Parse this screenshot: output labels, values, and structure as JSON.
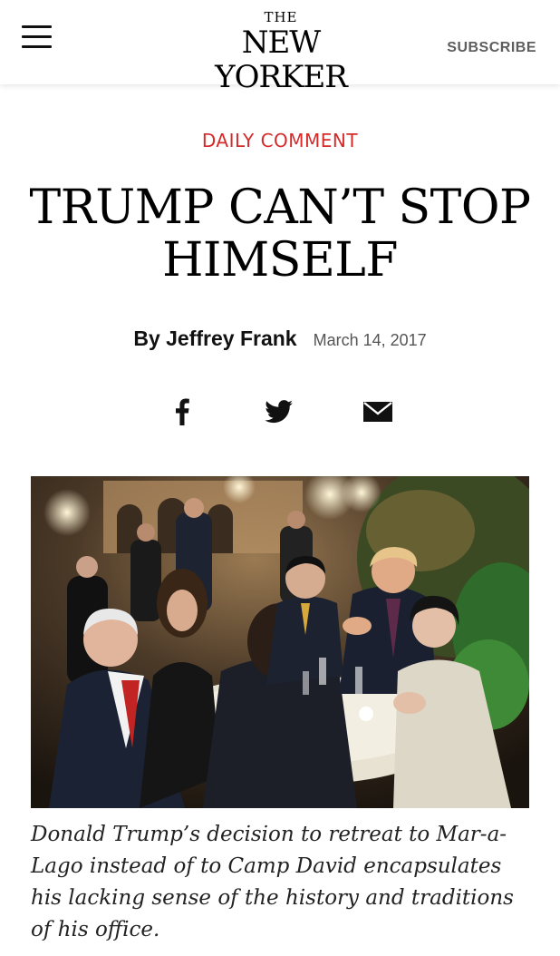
{
  "header": {
    "logo_top": "THE",
    "logo_name": "NEW YORKER",
    "subscribe_label": "SUBSCRIBE",
    "menu_icon": "hamburger-menu-icon"
  },
  "article": {
    "rubric": "DAILY COMMENT",
    "headline_line1": "TRUMP CAN’T STOP",
    "headline_line2": "HIMSELF",
    "byline": "By Jeffrey Frank",
    "date": "March 14, 2017",
    "caption": "Donald Trump’s decision to retreat to Mar-a-Lago instead of to Camp David encapsulates his lacking sense of the history and traditions of his office."
  },
  "share": {
    "facebook_icon": "facebook-icon",
    "twitter_icon": "twitter-icon",
    "email_icon": "email-icon"
  },
  "colors": {
    "rubric": "#d52a2a",
    "subscribe": "#5d5d5d",
    "text": "#111111"
  }
}
